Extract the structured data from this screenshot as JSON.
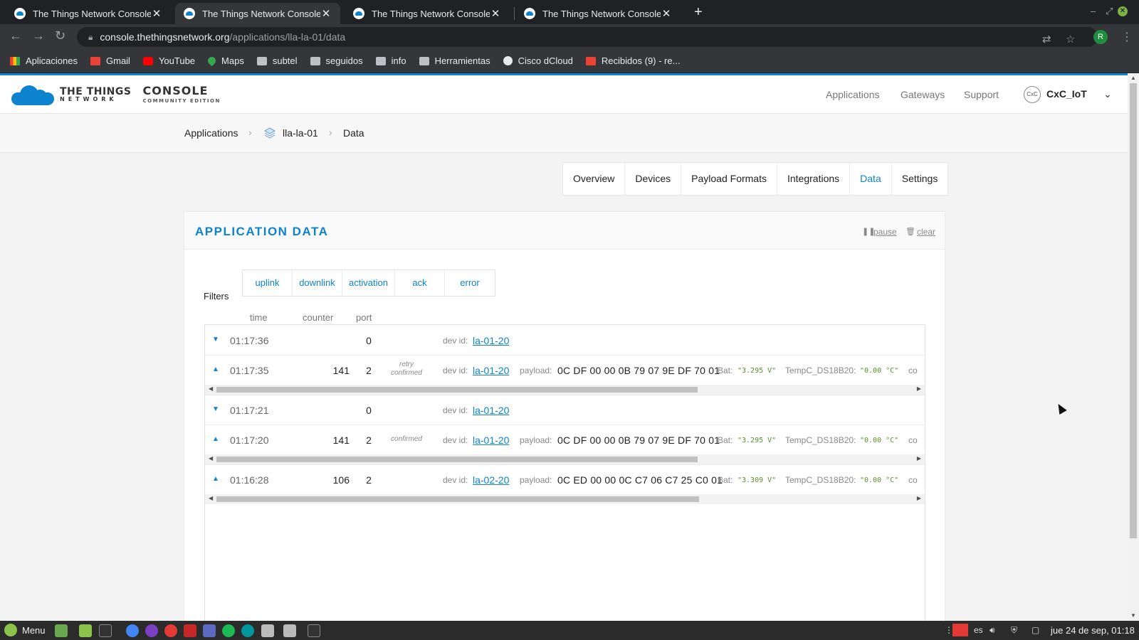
{
  "browser": {
    "tabs": [
      {
        "title": "The Things Network Console"
      },
      {
        "title": "The Things Network Console"
      },
      {
        "title": "The Things Network Console"
      },
      {
        "title": "The Things Network Console"
      }
    ],
    "url_host": "console.thethingsnetwork.org",
    "url_path": "/applications/lla-la-01/data",
    "profile_initial": "R",
    "bookmarks": [
      "Aplicaciones",
      "Gmail",
      "YouTube",
      "Maps",
      "subtel",
      "seguidos",
      "info",
      "Herramientas",
      "Cisco dCloud",
      "Recibidos (9) - re..."
    ]
  },
  "site": {
    "logo_line1": "THE THINGS",
    "logo_line2": "NETWORK",
    "logo_console": "CONSOLE",
    "logo_edition": "COMMUNITY EDITION",
    "nav": [
      "Applications",
      "Gateways",
      "Support"
    ],
    "user_name": "CxC_IoT",
    "user_avatar_text": "CxC"
  },
  "breadcrumb": {
    "items": [
      "Applications",
      "lla-la-01",
      "Data"
    ]
  },
  "tabs": [
    "Overview",
    "Devices",
    "Payload Formats",
    "Integrations",
    "Data",
    "Settings"
  ],
  "active_tab": "Data",
  "panel": {
    "title": "APPLICATION DATA",
    "pause_label": "pause",
    "clear_label": "clear",
    "filters_label": "Filters",
    "filters": [
      "uplink",
      "downlink",
      "activation",
      "ack",
      "error"
    ],
    "columns": {
      "time": "time",
      "counter": "counter",
      "port": "port"
    },
    "dev_id_label": "dev id:",
    "payload_label": "payload:",
    "bat_label": "Bat:",
    "temp_label": "TempC_DS18B20:",
    "more_label": "co",
    "rows": [
      {
        "dir": "down",
        "time": "01:17:36",
        "counter": "",
        "port": "0",
        "flags": [],
        "dev_id": "la-01-20",
        "payload": "",
        "bat": "",
        "temp": ""
      },
      {
        "dir": "up",
        "time": "01:17:35",
        "counter": "141",
        "port": "2",
        "flags": [
          "retry",
          "confirmed"
        ],
        "dev_id": "la-01-20",
        "payload": "0C DF 00 00 0B 79 07 9E DF 70 01",
        "bat": "\"3.295 V\"",
        "temp": "\"0.00 °C\""
      },
      {
        "dir": "down",
        "time": "01:17:21",
        "counter": "",
        "port": "0",
        "flags": [],
        "dev_id": "la-01-20",
        "payload": "",
        "bat": "",
        "temp": ""
      },
      {
        "dir": "up",
        "time": "01:17:20",
        "counter": "141",
        "port": "2",
        "flags": [
          "confirmed"
        ],
        "dev_id": "la-01-20",
        "payload": "0C DF 00 00 0B 79 07 9E DF 70 01",
        "bat": "\"3.295 V\"",
        "temp": "\"0.00 °C\""
      },
      {
        "dir": "up",
        "time": "01:16:28",
        "counter": "106",
        "port": "2",
        "flags": [],
        "dev_id": "la-02-20",
        "payload": "0C ED 00 00 0C C7 06 C7 25 C0 01",
        "bat": "\"3.309 V\"",
        "temp": "\"0.00 °C\""
      }
    ]
  },
  "taskbar": {
    "menu_label": "Menu",
    "keyboard_layout": "es",
    "clock": "jue 24 de sep, 01:18"
  },
  "colors": {
    "accent": "#0d83d0",
    "json_value": "#5a8f2b"
  }
}
